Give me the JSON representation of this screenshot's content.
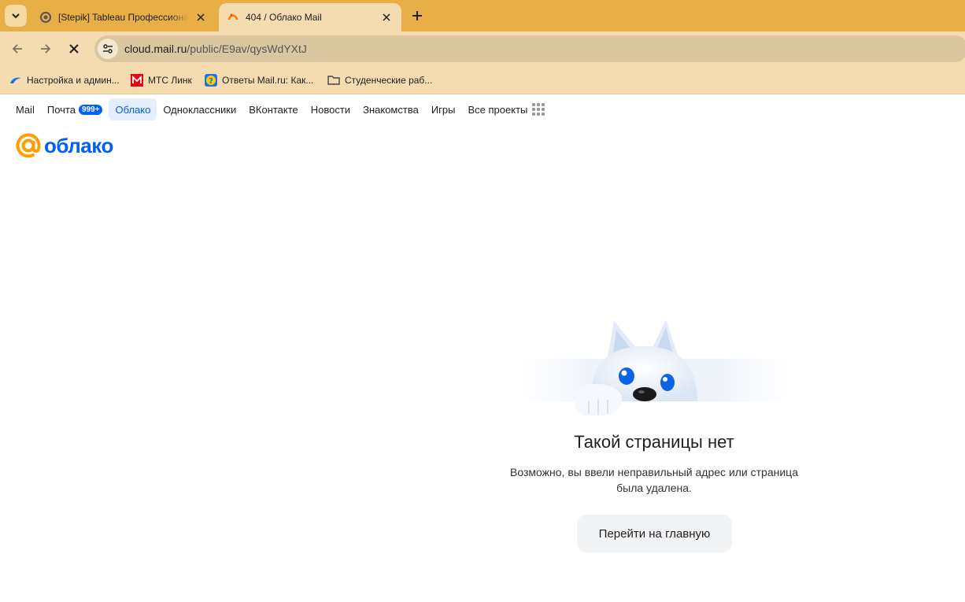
{
  "browser": {
    "tabs": [
      {
        "title": "[Stepik] Tableau Профессионал",
        "active": false,
        "favicon": "stepik-icon"
      },
      {
        "title": "404 / Облако Mail",
        "active": true,
        "favicon": "mail-cloud-icon"
      }
    ],
    "url_host": "cloud.mail.ru",
    "url_path": "/public/E9av/qysWdYXtJ",
    "bookmarks": [
      {
        "label": "Настройка и админ...",
        "icon": "cloud-icon"
      },
      {
        "label": "МТС Линк",
        "icon": "mts-link-icon"
      },
      {
        "label": "Ответы Mail.ru: Как...",
        "icon": "question-icon"
      },
      {
        "label": "Студенческие раб...",
        "icon": "folder-icon"
      }
    ]
  },
  "portal_nav": {
    "items": [
      "Mail",
      "Почта",
      "Облако",
      "Одноклассники",
      "ВКонтакте",
      "Новости",
      "Знакомства",
      "Игры",
      "Все проекты"
    ],
    "mail_badge": "999+",
    "active": "Облако"
  },
  "logo": {
    "text": "облако"
  },
  "error": {
    "title": "Такой страницы нет",
    "line1": "Возможно, вы ввели неправильный адрес или страница",
    "line2": "была удалена.",
    "button": "Перейти на главную"
  },
  "colors": {
    "accent": "#005ff9",
    "tabstrip": "#e9af47",
    "toolbar": "#f4dcb0",
    "logo_at": "#ff9e00"
  }
}
